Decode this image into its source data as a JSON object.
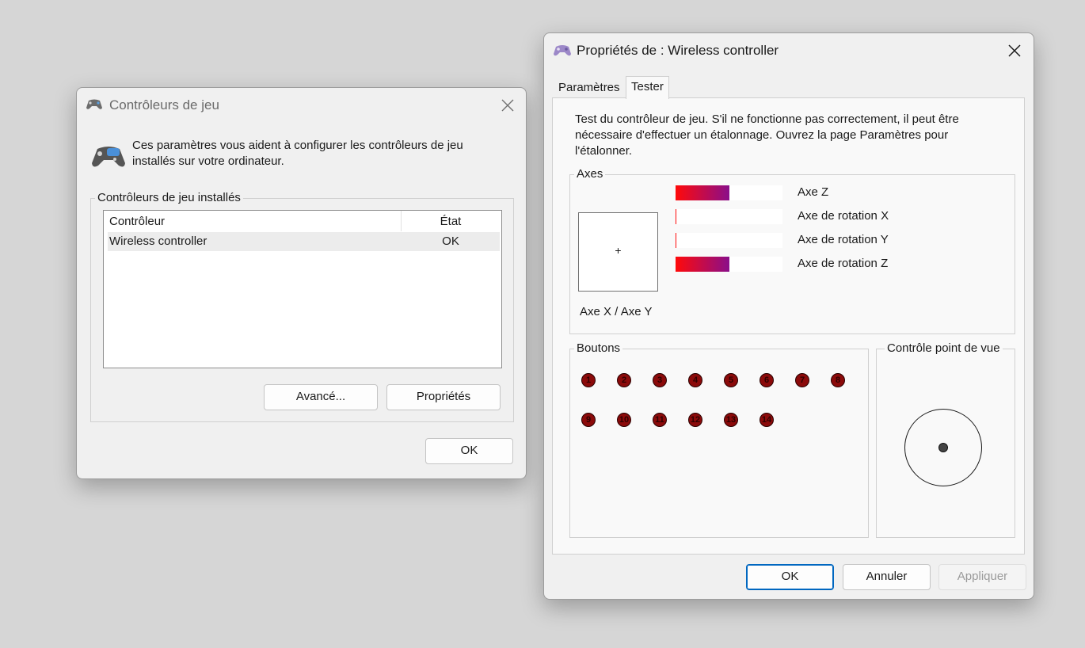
{
  "game_controllers_window": {
    "title": "Contrôleurs de jeu",
    "description_line1": "Ces paramètres vous aident à configurer les contrôleurs de jeu",
    "description_line2": "installés sur votre ordinateur.",
    "group_label": "Contrôleurs de jeu installés",
    "columns": {
      "controller": "Contrôleur",
      "status": "État"
    },
    "rows": [
      {
        "controller": "Wireless controller",
        "status": "OK"
      }
    ],
    "advanced_label": "Avancé...",
    "properties_label": "Propriétés",
    "ok_label": "OK"
  },
  "properties_window": {
    "title": "Propriétés de : Wireless controller",
    "tabs": [
      {
        "label": "Paramètres",
        "active": false
      },
      {
        "label": "Tester",
        "active": true
      }
    ],
    "intro_line1": "Test du contrôleur de jeu. S'il ne fonctionne pas correctement, il peut être",
    "intro_line2": "nécessaire d'effectuer un étalonnage. Ouvrez la page Paramètres pour",
    "intro_line3": "l'étalonner.",
    "axes_group_label": "Axes",
    "crosshair": "+",
    "xy_label": "Axe X / Axe Y",
    "axis_bars": [
      {
        "label": "Axe Z",
        "fraction": 0.5
      },
      {
        "label": "Axe de rotation X",
        "fraction": 0.0
      },
      {
        "label": "Axe de rotation Y",
        "fraction": 0.0
      },
      {
        "label": "Axe de rotation Z",
        "fraction": 0.5
      }
    ],
    "buttons_group_label": "Boutons",
    "buttons": [
      "1",
      "2",
      "3",
      "4",
      "5",
      "6",
      "7",
      "8",
      "9",
      "10",
      "11",
      "12",
      "13",
      "14"
    ],
    "pov_group_label": "Contrôle point de vue",
    "ok_label": "OK",
    "cancel_label": "Annuler",
    "apply_label": "Appliquer"
  },
  "colors": {
    "bar_gradient_start": "#ff0a0a",
    "bar_gradient_end": "#8a0e8a",
    "button_fill": "#8b0a0a",
    "primary_border": "#0067c0"
  },
  "icons": {
    "controller": "gamepad-icon",
    "close": "close-icon"
  }
}
